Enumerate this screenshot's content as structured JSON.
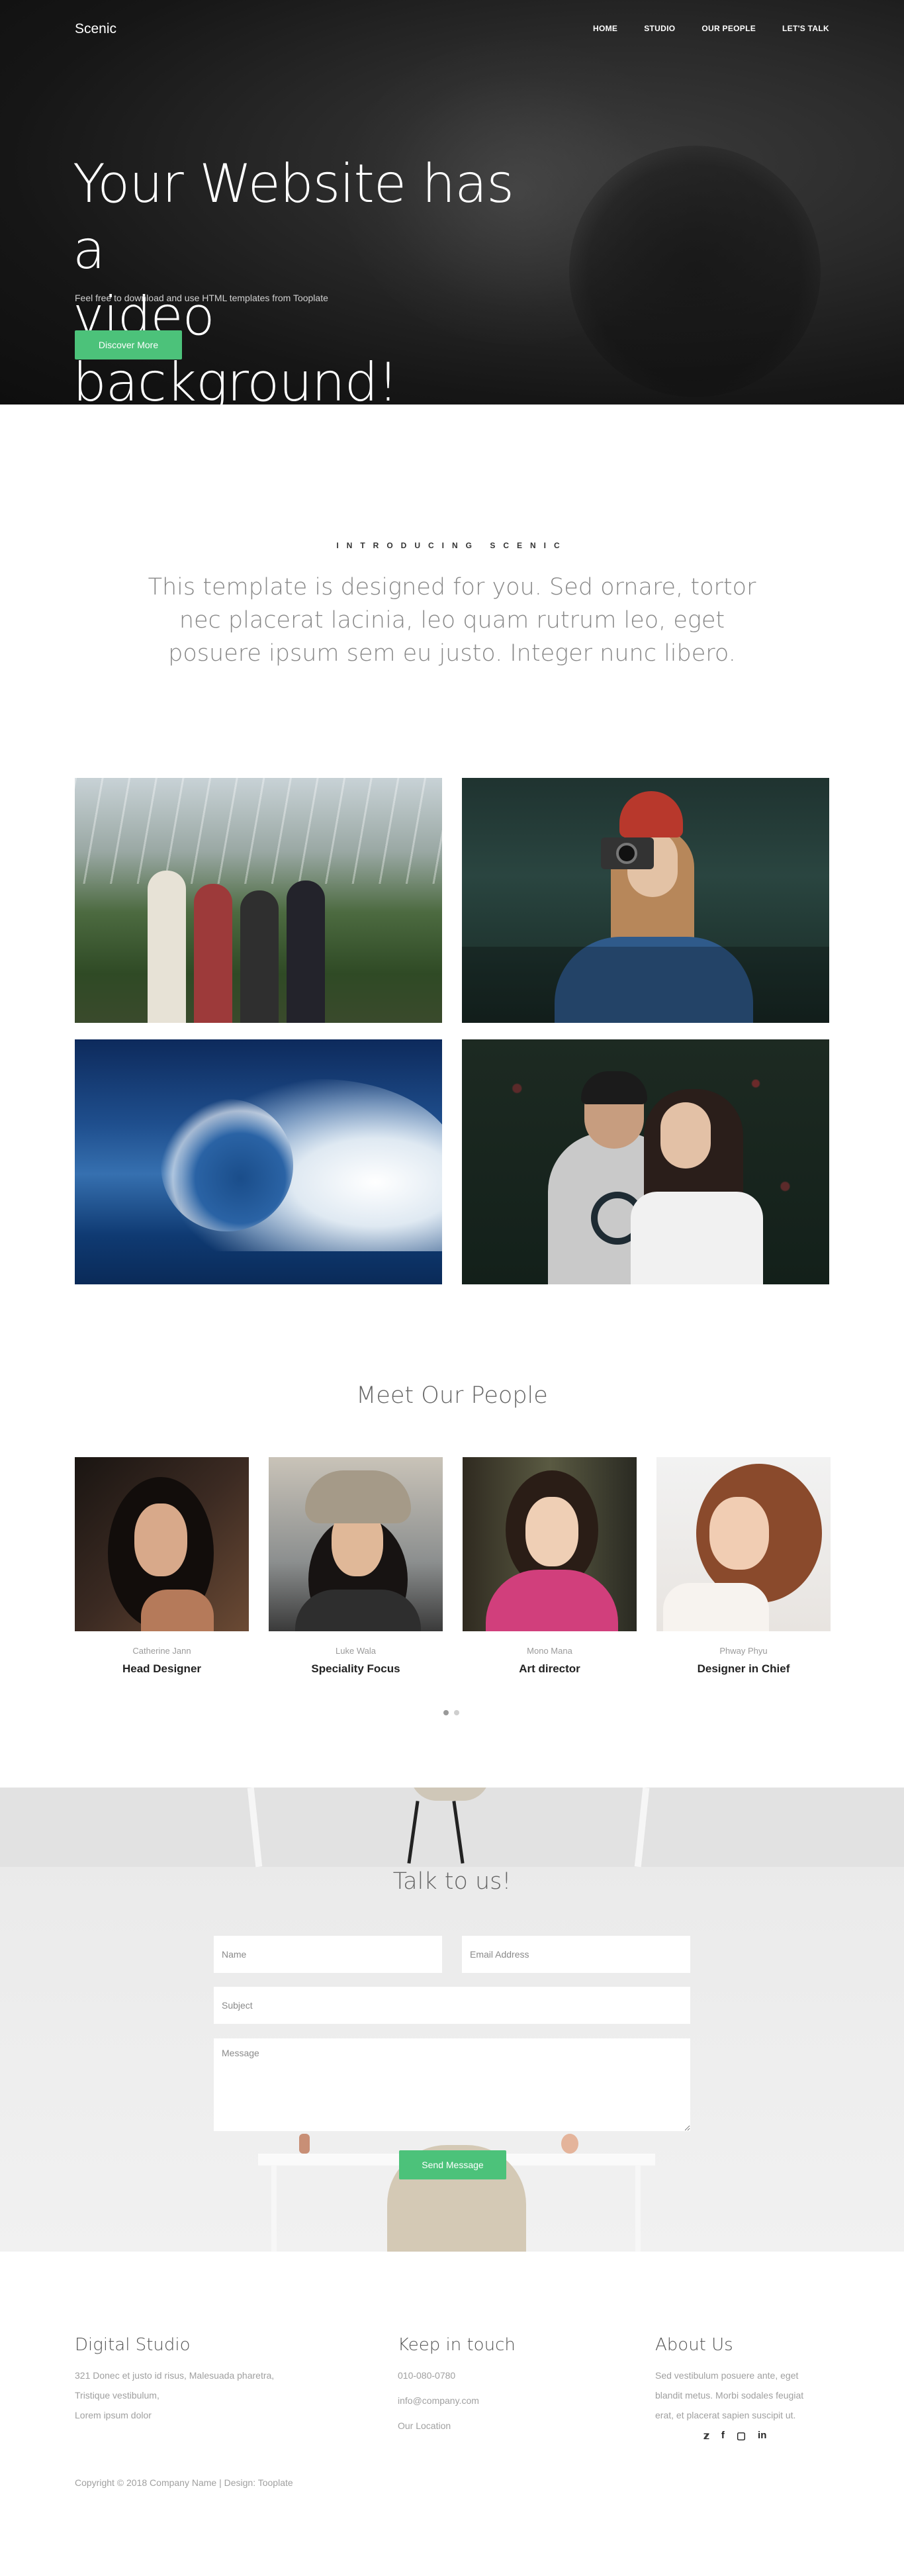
{
  "header": {
    "brand": "Scenic",
    "nav": [
      "HOME",
      "STUDIO",
      "OUR PEOPLE",
      "LET'S TALK"
    ]
  },
  "hero": {
    "title_line1": "Your Website has a",
    "title_line2": "video background!",
    "subtitle": "Feel free to download and use HTML templates from Tooplate",
    "button": "Discover More"
  },
  "intro": {
    "label": "INTRODUCING SCENIC",
    "text": "This template is designed for you. Sed ornare, tortor nec placerat lacinia, leo quam rutrum leo, eget posuere ipsum sem eu justo. Integer nunc libero."
  },
  "people": {
    "title": "Meet Our People",
    "members": [
      {
        "name": "Catherine Jann",
        "role": "Head Designer"
      },
      {
        "name": "Luke Wala",
        "role": "Speciality Focus"
      },
      {
        "name": "Mono Mana",
        "role": "Art director"
      },
      {
        "name": "Phway Phyu",
        "role": "Designer in Chief"
      }
    ]
  },
  "contact": {
    "title": "Talk to us!",
    "name_placeholder": "Name",
    "email_placeholder": "Email Address",
    "subject_placeholder": "Subject",
    "message_placeholder": "Message",
    "button": "Send Message"
  },
  "footer": {
    "col1": {
      "title": "Digital Studio",
      "lines": [
        "321 Donec et justo id risus, Malesuada pharetra,",
        "Tristique vestibulum,",
        "Lorem ipsum dolor"
      ]
    },
    "col2": {
      "title": "Keep in touch",
      "lines": [
        "010-080-0780",
        "info@company.com",
        "Our Location"
      ]
    },
    "col3": {
      "title": "About Us",
      "lines": [
        "Sed vestibulum posuere ante, eget",
        "blandit metus. Morbi sodales feugiat",
        "erat, et placerat sapien suscipit ut."
      ]
    },
    "social": [
      "twitter-icon",
      "facebook-icon",
      "instagram-icon",
      "linkedin-icon"
    ],
    "copyright": "Copyright © 2018 Company Name | Design: Tooplate"
  },
  "colors": {
    "accent": "#4cc27a",
    "hero_bg": "#1a1a1a"
  }
}
